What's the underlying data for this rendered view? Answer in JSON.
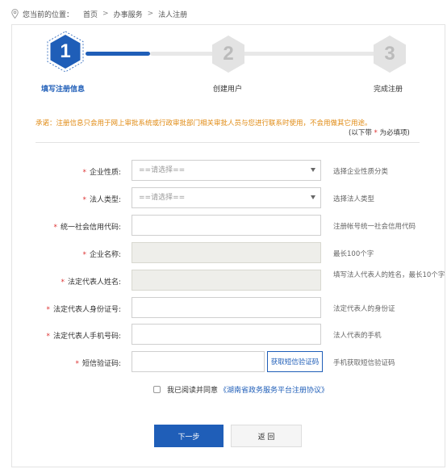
{
  "breadcrumb": {
    "prefix": "您当前的位置：",
    "items": [
      "首页",
      "办事服务",
      "法人注册"
    ],
    "separator": ">"
  },
  "steps": [
    {
      "number": "1",
      "label": "填写注册信息",
      "active": true
    },
    {
      "number": "2",
      "label": "创建用户",
      "active": false
    },
    {
      "number": "3",
      "label": "完成注册",
      "active": false
    }
  ],
  "notice": {
    "text": "承诺：注册信息只会用于网上审批系统或行政审批部门相关审批人员与您进行联系时使用，不会用做其它用途。",
    "required_prefix": "(以下带",
    "required_star": "*",
    "required_suffix": "为必填项)"
  },
  "form": {
    "enterprise_type": {
      "label": "企业性质:",
      "value": "==请选择==",
      "hint": "选择企业性质分类"
    },
    "legal_type": {
      "label": "法人类型:",
      "value": "==请选择==",
      "hint": "选择法人类型"
    },
    "credit_code": {
      "label": "统一社会信用代码:",
      "value": "",
      "hint": "注册帐号统一社会信用代码"
    },
    "company_name": {
      "label": "企业名称:",
      "value": "",
      "hint": "最长100个字"
    },
    "legal_rep_name": {
      "label": "法定代表人姓名:",
      "value": "",
      "hint": "填写法人代表人的姓名，最长10个字"
    },
    "legal_rep_id": {
      "label": "法定代表人身份证号:",
      "value": "",
      "hint": "法定代表人的身份证"
    },
    "legal_rep_phone": {
      "label": "法定代表人手机号码:",
      "value": "",
      "hint": "法人代表的手机"
    },
    "sms_code": {
      "label": "短信验证码:",
      "value": "",
      "hint": "手机获取短信验证码",
      "button": "获取短信验证码"
    },
    "required_mark": "*"
  },
  "agreement": {
    "text": "我已阅读并同意",
    "link": "《湖南省政务服务平台注册协议》",
    "checked": false
  },
  "buttons": {
    "next": "下一步",
    "back": "返  回"
  },
  "colors": {
    "primary": "#1f5eb8",
    "notice": "#e08a12",
    "required": "#d33333"
  }
}
